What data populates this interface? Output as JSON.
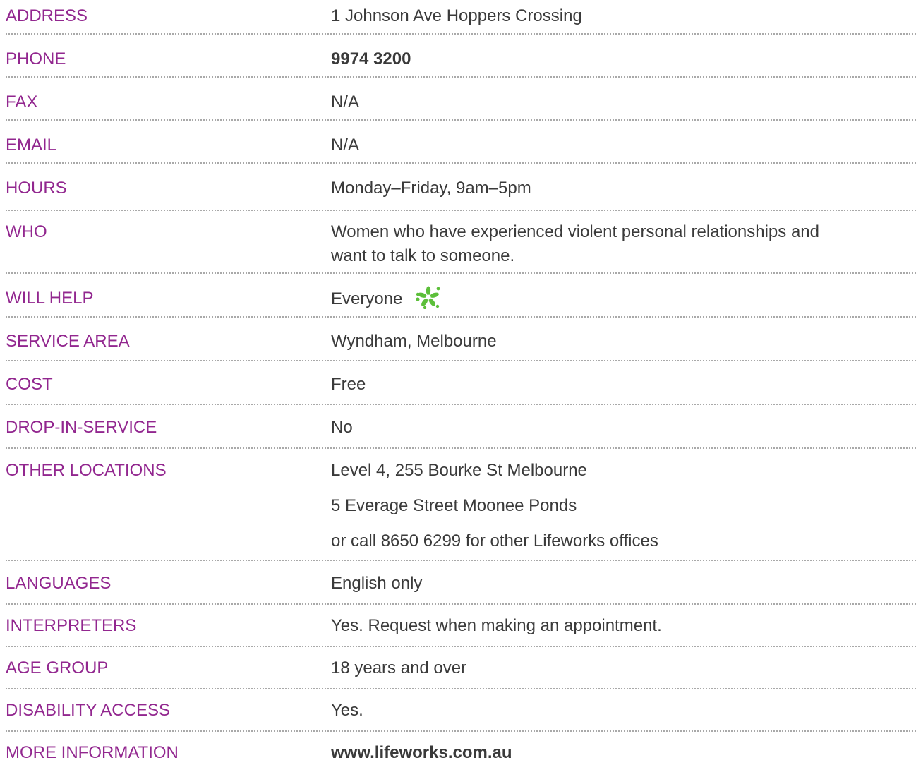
{
  "accent_label_color": "#92278f",
  "value_color": "#3a3a3a",
  "icon_color": "#5cbf3a",
  "rows": {
    "address": {
      "label": "ADDRESS",
      "value": "1 Johnson Ave Hoppers Crossing"
    },
    "phone": {
      "label": "PHONE",
      "value": "9974 3200"
    },
    "fax": {
      "label": "FAX",
      "value": "N/A"
    },
    "email": {
      "label": "EMAIL",
      "value": "N/A"
    },
    "hours": {
      "label": "HOURS",
      "value": "Monday–Friday, 9am–5pm"
    },
    "who": {
      "label": "WHO",
      "line1": "Women who have experienced violent personal relationships and",
      "line2": "want to talk to someone."
    },
    "will_help": {
      "label": "WILL HELP",
      "value": "Everyone",
      "icon": "flower-icon"
    },
    "service_area": {
      "label": "SERVICE AREA",
      "value": "Wyndham, Melbourne"
    },
    "cost": {
      "label": "COST",
      "value": "Free"
    },
    "drop_in": {
      "label": "DROP-IN-SERVICE",
      "value": "No"
    },
    "other_locations": {
      "label": "OTHER LOCATIONS",
      "values": [
        "Level 4, 255 Bourke St Melbourne",
        "5 Everage Street Moonee Ponds",
        "or call 8650 6299 for other Lifeworks offices"
      ]
    },
    "languages": {
      "label": "LANGUAGES",
      "value": "English only"
    },
    "interpreters": {
      "label": "INTERPRETERS",
      "value": "Yes. Request when making an appointment."
    },
    "age_group": {
      "label": "AGE GROUP",
      "value": "18 years and over"
    },
    "disability_access": {
      "label": "DISABILITY ACCESS",
      "value": "Yes."
    },
    "more_information": {
      "label": "MORE INFORMATION",
      "value": "www.lifeworks.com.au"
    }
  }
}
